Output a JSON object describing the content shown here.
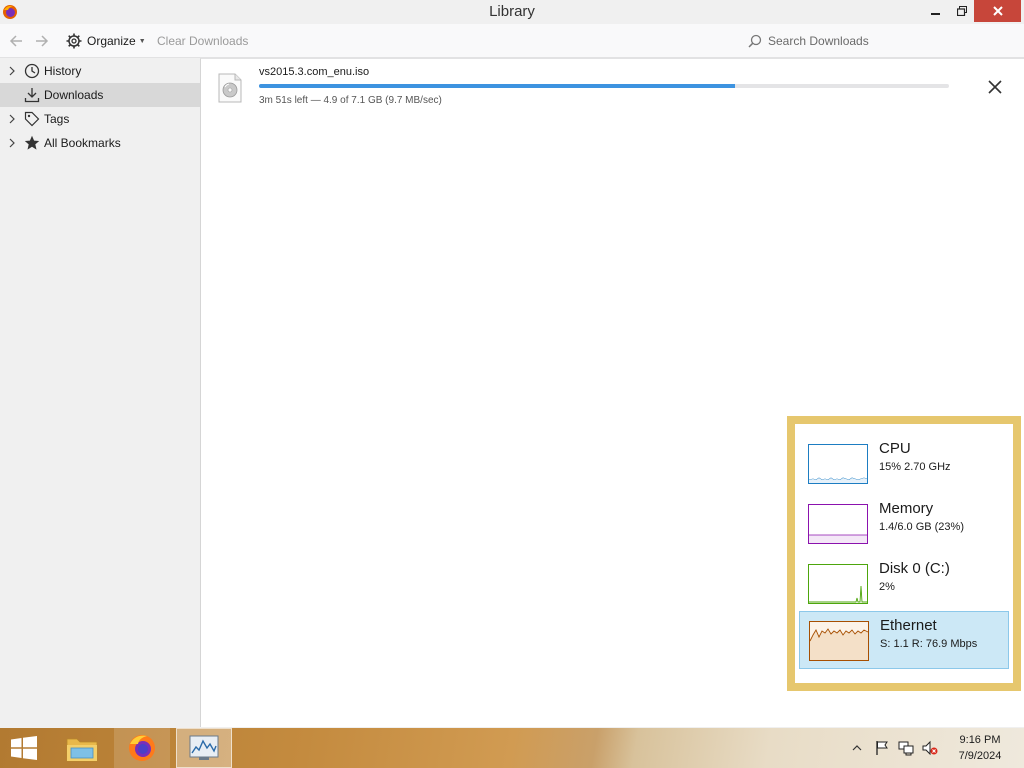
{
  "window": {
    "title": "Library"
  },
  "toolbar": {
    "organize_label": "Organize",
    "clear_label": "Clear Downloads",
    "search_placeholder": "Search Downloads"
  },
  "sidebar": {
    "items": [
      {
        "label": "History",
        "icon": "clock-icon",
        "expandable": true
      },
      {
        "label": "Downloads",
        "icon": "download-icon",
        "expandable": false,
        "selected": true
      },
      {
        "label": "Tags",
        "icon": "tag-icon",
        "expandable": true
      },
      {
        "label": "All Bookmarks",
        "icon": "star-icon",
        "expandable": true
      }
    ]
  },
  "downloads": [
    {
      "filename": "vs2015.3.com_enu.iso",
      "progress_fraction": 0.69,
      "status": "3m 51s left — 4.9 of 7.1 GB (9.7 MB/sec)"
    }
  ],
  "task_manager": {
    "items": [
      {
        "name": "CPU",
        "value": "15%  2.70 GHz",
        "color": "#1d7dc2"
      },
      {
        "name": "Memory",
        "value": "1.4/6.0 GB (23%)",
        "color": "#8b12ae"
      },
      {
        "name": "Disk 0 (C:)",
        "value": "2%",
        "color": "#4da60c"
      },
      {
        "name": "Ethernet",
        "value": "S: 1.1  R: 76.9 Mbps",
        "color": "#a74f01",
        "selected": true
      }
    ]
  },
  "taskbar": {
    "clock_time": "9:16 PM",
    "clock_date": "7/9/2024"
  },
  "colors": {
    "progress": "#3d93e0",
    "close_button": "#c7463a",
    "taskmanager_border": "#e6c76e"
  }
}
